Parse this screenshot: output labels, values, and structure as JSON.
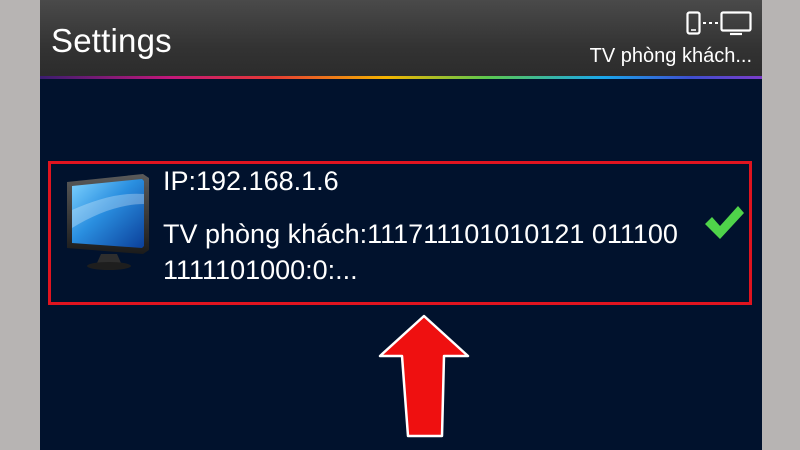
{
  "header": {
    "title": "Settings",
    "connected_device": "TV phòng khách...",
    "connection_icon": "phone-to-tv-icon"
  },
  "device": {
    "ip": "IP:192.168.1.6",
    "name_line": "TV phòng khách:111711101010121 0111001111101000:0:...",
    "icon": "tv-icon",
    "status_icon": "checkmark-icon",
    "selected": true
  },
  "colors": {
    "background": "#01122d",
    "highlight_border": "#e0141f",
    "arrow": "#ef1010",
    "check": "#4fd34a"
  }
}
